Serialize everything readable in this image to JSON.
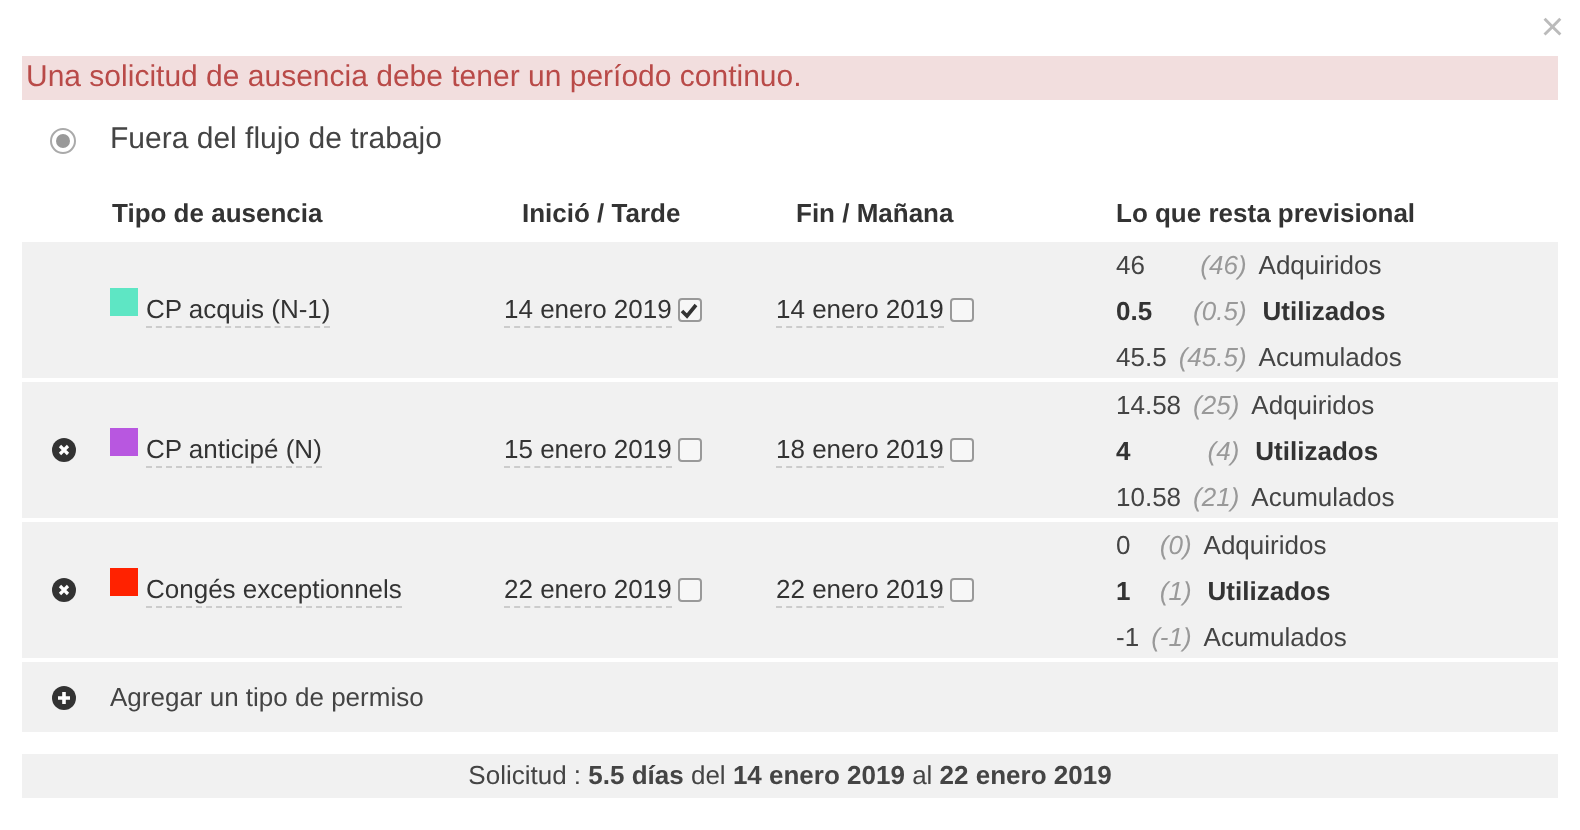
{
  "close_button": "×",
  "alert": "Una solicitud de ausencia debe tener un período continuo.",
  "workflow_option": {
    "label": "Fuera del flujo de trabajo",
    "selected": true
  },
  "table": {
    "columns": [
      "Tipo de ausencia",
      "Inició / Tarde",
      "Fin / Mañana",
      "Lo que resta previsional"
    ],
    "rows": [
      {
        "removable": false,
        "type": "CP acquis (N-1)",
        "color": "#5ee6c4",
        "start": "14 enero 2019",
        "start_checked": true,
        "end": "14 enero 2019",
        "end_checked": false,
        "balance": [
          {
            "value": "46",
            "previous": "(46)",
            "label": "Adquiridos",
            "bold": false
          },
          {
            "value": "0.5",
            "previous": "(0.5)",
            "label": "Utilizados",
            "bold": true
          },
          {
            "value": "45.5",
            "previous": "(45.5)",
            "label": "Acumulados",
            "bold": false
          }
        ]
      },
      {
        "removable": true,
        "type": "CP anticipé (N)",
        "color": "#b857e0",
        "start": "15 enero 2019",
        "start_checked": false,
        "end": "18 enero 2019",
        "end_checked": false,
        "balance": [
          {
            "value": "14.58",
            "previous": "(25)",
            "label": "Adquiridos",
            "bold": false
          },
          {
            "value": "4",
            "previous": "(4)",
            "label": "Utilizados",
            "bold": true
          },
          {
            "value": "10.58",
            "previous": "(21)",
            "label": "Acumulados",
            "bold": false
          }
        ]
      },
      {
        "removable": true,
        "type": "Congés exceptionnels",
        "color": "#ff2200",
        "start": "22 enero 2019",
        "start_checked": false,
        "end": "22 enero 2019",
        "end_checked": false,
        "balance": [
          {
            "value": "0",
            "previous": "(0)",
            "label": "Adquiridos",
            "bold": false
          },
          {
            "value": "1",
            "previous": "(1)",
            "label": "Utilizados",
            "bold": true
          },
          {
            "value": "-1",
            "previous": "(-1)",
            "label": "Acumulados",
            "bold": false
          }
        ]
      }
    ]
  },
  "add_row": "Agregar un tipo de permiso",
  "summary": "Solicitud : **5.5 días** del **14 enero 2019** al **22 enero 2019**"
}
